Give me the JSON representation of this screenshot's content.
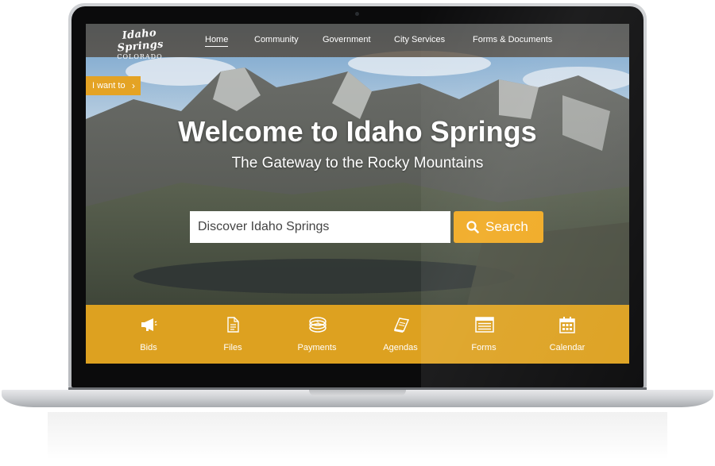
{
  "site": {
    "logo_main": "Idaho Springs",
    "logo_sub": "COLORADO"
  },
  "nav": {
    "items": [
      {
        "label": "Home",
        "active": true
      },
      {
        "label": "Community"
      },
      {
        "label": "Government"
      },
      {
        "label": "City Services"
      },
      {
        "label": "Forms & Documents"
      }
    ]
  },
  "i_want": {
    "label": "I want to",
    "icon": "chevron-right-icon"
  },
  "hero": {
    "title": "Welcome to Idaho Springs",
    "subtitle": "The Gateway to the Rocky Mountains"
  },
  "search": {
    "placeholder": "Discover Idaho Springs",
    "button_label": "Search",
    "button_icon": "search-icon"
  },
  "quick_links": [
    {
      "label": "Bids",
      "icon": "megaphone-icon"
    },
    {
      "label": "Files",
      "icon": "document-icon"
    },
    {
      "label": "Payments",
      "icon": "coins-icon"
    },
    {
      "label": "Agendas",
      "icon": "book-icon"
    },
    {
      "label": "Forms",
      "icon": "form-list-icon"
    },
    {
      "label": "Calendar",
      "icon": "calendar-icon"
    }
  ],
  "colors": {
    "accent": "#e4a324",
    "tile_bar": "#dda120",
    "nav_bg": "#4b3a28"
  }
}
